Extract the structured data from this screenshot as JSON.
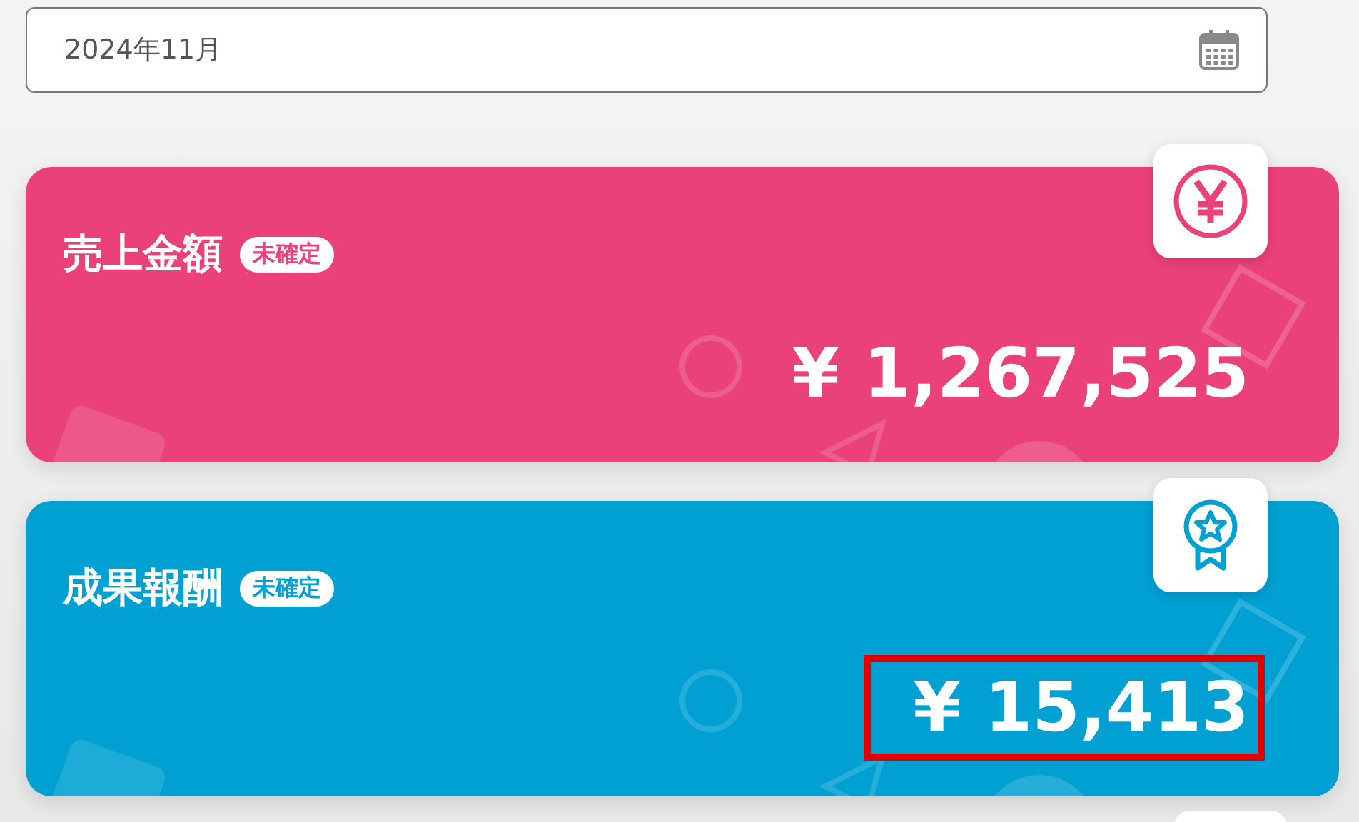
{
  "month_field": {
    "value": "2024年11月"
  },
  "cards": [
    {
      "kind": "yen",
      "title": "売上金額",
      "badge": "未確定",
      "amount": "¥ 1,267,525",
      "color": "#ea4179",
      "highlighted": false
    },
    {
      "kind": "medal",
      "title": "成果報酬",
      "badge": "未確定",
      "amount": "¥ 15,413",
      "color": "#00a0d2",
      "highlighted": true
    }
  ],
  "next_card": {
    "kind": "partial"
  }
}
